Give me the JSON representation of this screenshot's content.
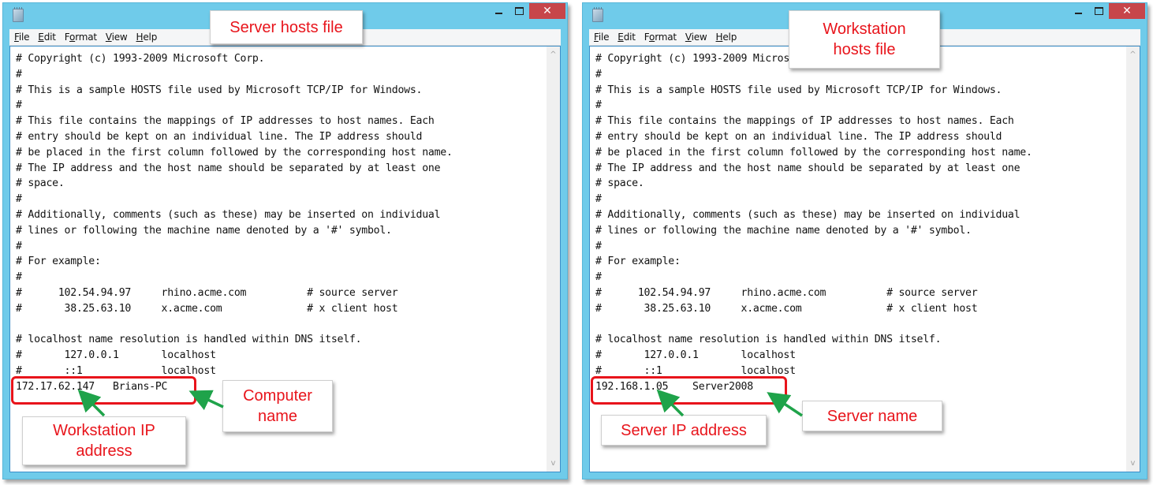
{
  "windows": [
    {
      "id": "server",
      "menu": [
        {
          "label": "File",
          "accel": "F",
          "rest": "ile"
        },
        {
          "label": "Edit",
          "accel": "E",
          "rest": "dit"
        },
        {
          "label": "Format",
          "pre": "F",
          "accel": "o",
          "rest": "rmat"
        },
        {
          "label": "View",
          "accel": "V",
          "rest": "iew"
        },
        {
          "label": "Help",
          "accel": "H",
          "rest": "elp"
        }
      ],
      "window_controls": {
        "minimize": "minimize",
        "maximize": "maximize",
        "close": "✕"
      },
      "scroll_up": "^",
      "scroll_down": "v",
      "lines": [
        "# Copyright (c) 1993-2009 Microsoft Corp.",
        "#",
        "# This is a sample HOSTS file used by Microsoft TCP/IP for Windows.",
        "#",
        "# This file contains the mappings of IP addresses to host names. Each",
        "# entry should be kept on an individual line. The IP address should",
        "# be placed in the first column followed by the corresponding host name.",
        "# The IP address and the host name should be separated by at least one",
        "# space.",
        "#",
        "# Additionally, comments (such as these) may be inserted on individual",
        "# lines or following the machine name denoted by a '#' symbol.",
        "#",
        "# For example:",
        "#",
        "#      102.54.94.97     rhino.acme.com          # source server",
        "#       38.25.63.10     x.acme.com              # x client host",
        "",
        "# localhost name resolution is handled within DNS itself.",
        "#       127.0.0.1       localhost",
        "#       ::1             localhost",
        "172.17.62.147   Brians-PC"
      ],
      "callouts": {
        "title": "Server hosts file",
        "ip": "Workstation IP address",
        "name": "Computer name"
      }
    },
    {
      "id": "workstation",
      "menu": [
        {
          "label": "File",
          "accel": "F",
          "rest": "ile"
        },
        {
          "label": "Edit",
          "accel": "E",
          "rest": "dit"
        },
        {
          "label": "Format",
          "pre": "F",
          "accel": "o",
          "rest": "rmat"
        },
        {
          "label": "View",
          "accel": "V",
          "rest": "iew"
        },
        {
          "label": "Help",
          "accel": "H",
          "rest": "elp"
        }
      ],
      "window_controls": {
        "minimize": "minimize",
        "maximize": "maximize",
        "close": "✕"
      },
      "scroll_up": "^",
      "scroll_down": "v",
      "lines": [
        "# Copyright (c) 1993-2009 Microsoft Corp.",
        "#",
        "# This is a sample HOSTS file used by Microsoft TCP/IP for Windows.",
        "#",
        "# This file contains the mappings of IP addresses to host names. Each",
        "# entry should be kept on an individual line. The IP address should",
        "# be placed in the first column followed by the corresponding host name.",
        "# The IP address and the host name should be separated by at least one",
        "# space.",
        "#",
        "# Additionally, comments (such as these) may be inserted on individual",
        "# lines or following the machine name denoted by a '#' symbol.",
        "#",
        "# For example:",
        "#",
        "#      102.54.94.97     rhino.acme.com          # source server",
        "#       38.25.63.10     x.acme.com              # x client host",
        "",
        "# localhost name resolution is handled within DNS itself.",
        "#       127.0.0.1       localhost",
        "#       ::1             localhost",
        "192.168.1.05    Server2008"
      ],
      "callouts": {
        "title": "Workstation hosts file",
        "ip": "Server IP address",
        "name": "Server name"
      }
    }
  ],
  "colors": {
    "frame": "#6fcbea",
    "close_button": "#c7464a",
    "annotation_red": "#e8141b",
    "arrow_green": "#1fa34a"
  }
}
